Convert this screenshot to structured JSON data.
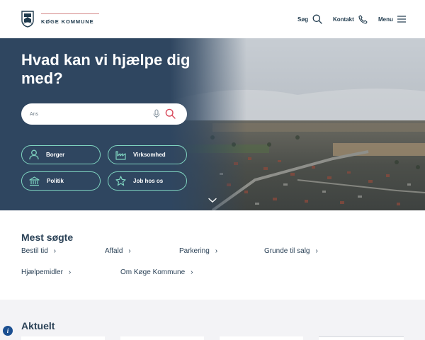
{
  "header": {
    "brand": "KØGE KOMMUNE",
    "nav": {
      "search_label": "Søg",
      "contact_label": "Kontakt",
      "menu_label": "Menu"
    }
  },
  "hero": {
    "title": "Hvad kan vi hjælpe dig med?",
    "search_placeholder": "Ans",
    "buttons": [
      {
        "label": "Borger",
        "icon": "person-icon"
      },
      {
        "label": "Virksomhed",
        "icon": "factory-icon"
      },
      {
        "label": "Politik",
        "icon": "government-building-icon"
      },
      {
        "label": "Job hos os",
        "icon": "star-icon"
      }
    ]
  },
  "most_searched": {
    "title": "Mest søgte",
    "links": [
      "Bestil tid",
      "Affald",
      "Parkering",
      "Grunde til salg",
      "Hjælpemidler",
      "Om Køge Kommune"
    ]
  },
  "news": {
    "title": "Aktuelt"
  },
  "colors": {
    "navy": "#2f4660",
    "text": "#1f3a4d",
    "accent_green": "#7fd4c0",
    "accent_red": "#d8485a",
    "info_blue": "#1b4f91"
  }
}
